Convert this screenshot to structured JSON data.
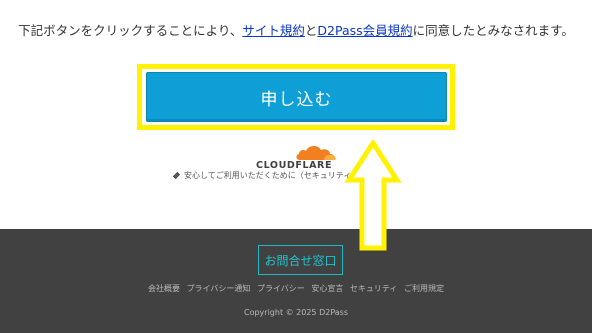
{
  "consent": {
    "prefix": "下記ボタンをクリックすることにより、",
    "site_terms_link": "サイト規約",
    "and": "と",
    "member_terms_link": "D2Pass会員規約",
    "suffix": "に同意したとみなされます。"
  },
  "submit_label": "申し込む",
  "cloudflare": {
    "logo_text": "CLOUDFLARE",
    "security_note": "安心してご利用いただくために（セキュリティについて）"
  },
  "footer": {
    "contact_label": "お問合せ窓口",
    "links": [
      "会社概要",
      "プライバシー通知",
      "プライバシー",
      "安心宣言",
      "セキュリティ",
      "ご利用規定"
    ],
    "copyright": "Copyright © 2025 D2Pass"
  },
  "colors": {
    "submit_bg": "#0d9fd6",
    "highlight": "#fff200",
    "footer_bg": "#414141",
    "contact_accent": "#20c5cf",
    "link": "#0a36c9",
    "cloudflare_orange": "#f38020"
  },
  "icons": {
    "note_icon": "link-icon",
    "cloud_icon": "cloudflare-cloud-icon",
    "annotation_arrow": "up-arrow-icon"
  }
}
